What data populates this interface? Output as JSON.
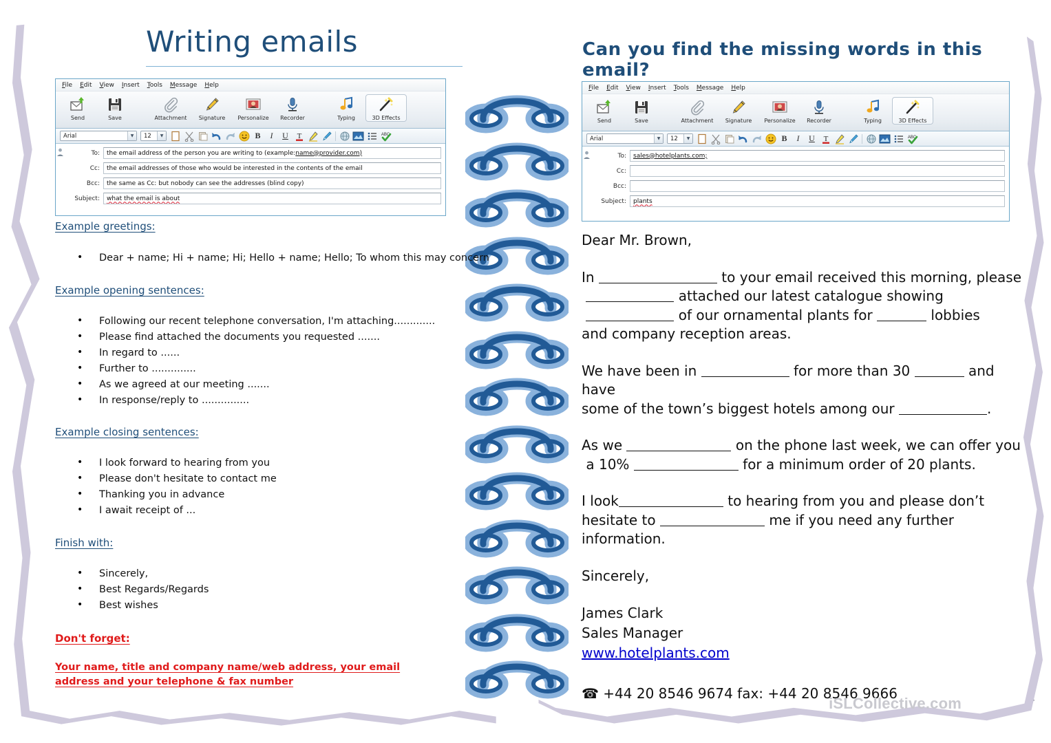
{
  "left_page": {
    "title": "Writing emails",
    "mail_client": {
      "menu": [
        "File",
        "Edit",
        "View",
        "Insert",
        "Tools",
        "Message",
        "Help"
      ],
      "ribbon_buttons": [
        {
          "label": "Send",
          "icon": "send-envelope-icon"
        },
        {
          "label": "Save",
          "icon": "floppy-disk-icon"
        },
        {
          "label": "Attachment",
          "icon": "paperclip-icon"
        },
        {
          "label": "Signature",
          "icon": "pen-icon"
        },
        {
          "label": "Personalize",
          "icon": "photo-portrait-icon"
        },
        {
          "label": "Recorder",
          "icon": "microphone-icon"
        },
        {
          "label": "Typing",
          "icon": "music-note-icon"
        },
        {
          "label": "3D Effects",
          "icon": "magic-wand-icon"
        }
      ],
      "font_name": "Arial",
      "font_size": "12",
      "format_icons": [
        "new-page-icon",
        "cut-scissors-icon",
        "paste-icon",
        "undo-icon",
        "redo-icon",
        "smiley-icon",
        "bold-icon",
        "italic-icon",
        "underline-icon",
        "font-color-icon",
        "highlighter-icon",
        "format-painter-icon",
        "hyperlink-icon",
        "insert-picture-icon",
        "bullet-list-icon",
        "spellcheck-icon"
      ],
      "format_glyphs": [
        "B",
        "I",
        "U",
        "T"
      ],
      "fields": [
        {
          "label": "To:",
          "value": "the email address of the person you are writing to (example: name@provider.com)"
        },
        {
          "label": "Cc:",
          "value": "the email addresses of those who would be interested in the contents of the email"
        },
        {
          "label": "Bcc:",
          "value": "the same as Cc: but nobody can see the addresses (blind copy)"
        },
        {
          "label": "Subject:",
          "value": "what the email is about"
        }
      ]
    },
    "sections": [
      {
        "heading": "Example greetings:",
        "items": [
          "Dear + name; Hi + name; Hi; Hello + name; Hello; To whom this may concern"
        ]
      },
      {
        "heading": "Example opening sentences:",
        "items": [
          "Following our recent telephone conversation, I'm attaching.............",
          "Please find attached the documents you requested .......",
          "In regard to ......",
          "Further to ..............",
          "As we agreed at our meeting .......",
          "In response/reply to ..............."
        ]
      },
      {
        "heading": "Example closing sentences:",
        "items": [
          "I look forward to hearing from you",
          "Please don't hesitate to contact me",
          "Thanking you in advance",
          "I await receipt of ..."
        ]
      },
      {
        "heading": "Finish with:",
        "items": [
          "Sincerely,",
          "Best Regards/Regards",
          "Best wishes"
        ]
      }
    ],
    "dont_forget": {
      "heading": "Don't forget:",
      "text": "Your name, title and company name/web address, your email address and your telephone & fax number"
    }
  },
  "right_page": {
    "title": "Can you find the missing words in this email?",
    "mail_client": {
      "menu": [
        "File",
        "Edit",
        "View",
        "Insert",
        "Tools",
        "Message",
        "Help"
      ],
      "ribbon_buttons": [
        {
          "label": "Send",
          "icon": "send-envelope-icon"
        },
        {
          "label": "Save",
          "icon": "floppy-disk-icon"
        },
        {
          "label": "Attachment",
          "icon": "paperclip-icon"
        },
        {
          "label": "Signature",
          "icon": "pen-icon"
        },
        {
          "label": "Personalize",
          "icon": "photo-portrait-icon"
        },
        {
          "label": "Recorder",
          "icon": "microphone-icon"
        },
        {
          "label": "Typing",
          "icon": "music-note-icon"
        },
        {
          "label": "3D Effects",
          "icon": "magic-wand-icon"
        }
      ],
      "font_name": "Arial",
      "font_size": "12",
      "fields": [
        {
          "label": "To:",
          "value": "sales@hotelplants.com;"
        },
        {
          "label": "Cc:",
          "value": ""
        },
        {
          "label": "Bcc:",
          "value": ""
        },
        {
          "label": "Subject:",
          "value": "plants"
        }
      ]
    },
    "email": {
      "greeting": "Dear Mr. Brown,",
      "para1": {
        "a": "In",
        "b": "to your email received this morning, please",
        "c": "attached our latest catalogue showing",
        "d": "of our ornamental plants for",
        "e": "lobbies",
        "f": "and company reception areas."
      },
      "para2": {
        "a": "We have been in",
        "b": "for more than 30",
        "c": "and have",
        "d": "some of the town’s biggest hotels among our",
        "e": "."
      },
      "para3": {
        "a": "As we",
        "b": "on the phone last week, we can offer you",
        "c": "a 10%",
        "d": "for a minimum order of 20 plants."
      },
      "para4": {
        "a": "I look",
        "b": "to hearing from you and please don’t",
        "c": "hesitate to",
        "d": "me if you need any further",
        "e": "information."
      },
      "closing": "Sincerely,",
      "signature_name": "James Clark",
      "signature_role": "Sales Manager",
      "signature_url": "www.hotelplants.com",
      "phone_icon": "telephone-icon",
      "phone_line": "+44 20 8546 9674 fax: +44 20 8546 9666"
    }
  },
  "watermark": "iSLCollective.com",
  "corner_mark": ".",
  "colors": {
    "heading_blue": "#1f4e79",
    "alert_red": "#e01b1b",
    "link_blue": "#0000cc",
    "ring_dark": "#215a96",
    "ring_light": "#8ab2dc",
    "page_shadow": "#c6c0d6",
    "watermark_grey": "#c9c9cf"
  }
}
